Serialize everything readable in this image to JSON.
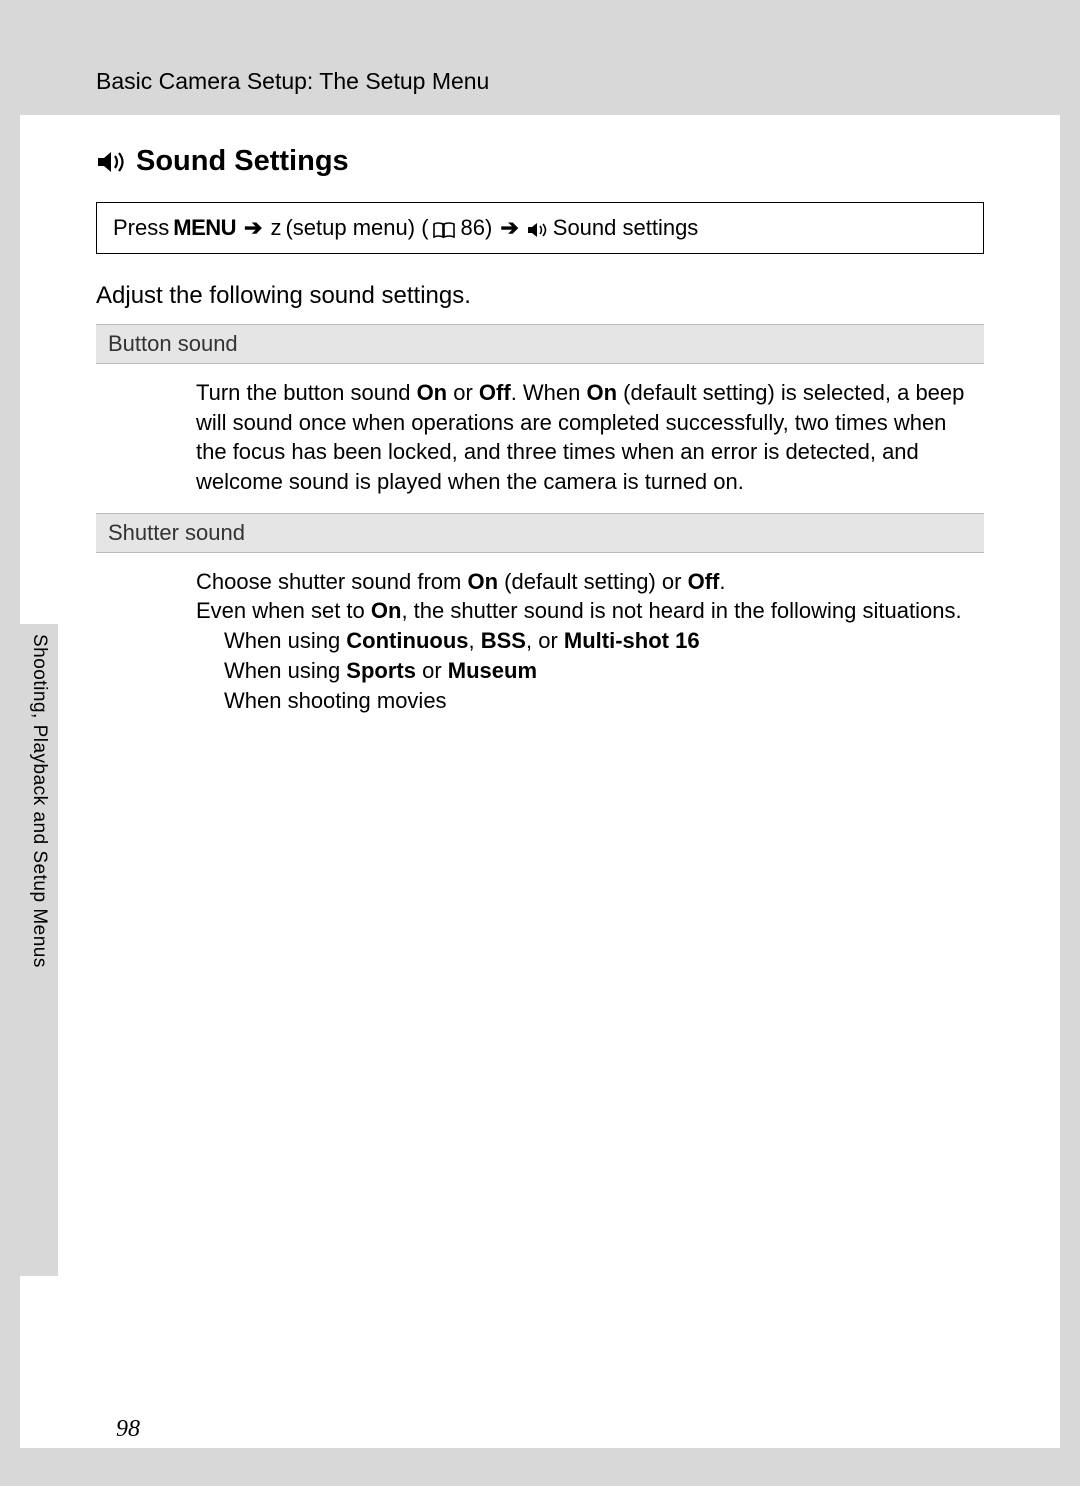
{
  "header": "Basic Camera Setup: The Setup Menu",
  "section_title": "Sound Settings",
  "breadcrumb": {
    "press": "Press",
    "menu": "MENU",
    "z": "z",
    "setup_menu": "(setup menu) (",
    "page_ref": "86)",
    "final": "Sound settings"
  },
  "intro": "Adjust the following sound settings.",
  "button_sound": {
    "title": "Button sound",
    "body_parts": [
      "Turn the button sound ",
      "On",
      " or ",
      "Off",
      ". When ",
      "On",
      " (default setting) is selected, a beep will sound once when operations are completed successfully, two times when the focus has been locked, and three times when an error is detected, and welcome sound is played when the camera is turned on."
    ]
  },
  "shutter_sound": {
    "title": "Shutter sound",
    "line1_parts": [
      "Choose shutter sound from ",
      "On",
      " (default setting) or ",
      "Off",
      "."
    ],
    "line2_parts": [
      "Even when set to ",
      "On",
      ", the shutter sound is not heard in the following situations."
    ],
    "bullet1_parts": [
      "When using ",
      "Continuous",
      ", ",
      "BSS",
      ", or ",
      "Multi-shot 16"
    ],
    "bullet2_parts": [
      "When using ",
      "Sports",
      " or ",
      "Museum"
    ],
    "bullet3": "When shooting movies"
  },
  "side_tab": "Shooting, Playback and Setup Menus",
  "page_number": "98"
}
